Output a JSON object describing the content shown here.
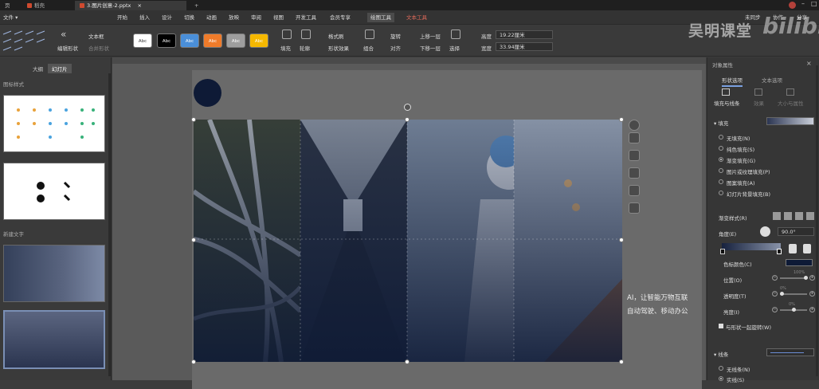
{
  "tabs": [
    {
      "label": "页",
      "active": false
    },
    {
      "label": "稻壳",
      "active": false
    },
    {
      "label": "3.图片创意-2.pptx",
      "active": true
    }
  ],
  "menu": {
    "file": "文件",
    "items": [
      "开始",
      "插入",
      "设计",
      "切换",
      "动画",
      "放映",
      "审阅",
      "视图",
      "开发工具",
      "会员专享"
    ],
    "active_tool": "绘图工具",
    "text_tool": "文本工具",
    "right_items": [
      "未同步",
      "协作",
      "分享"
    ]
  },
  "ribbon": {
    "text_box": "文本框",
    "merge_shapes": "合并形状",
    "edit_shape": "编辑形状",
    "style_swatches": [
      {
        "label": "Abc",
        "bg": "#ffffff",
        "fg": "#333333"
      },
      {
        "label": "Abc",
        "bg": "#000000",
        "fg": "#ffffff"
      },
      {
        "label": "Abc",
        "bg": "#4a8fd9",
        "fg": "#ffffff"
      },
      {
        "label": "Abc",
        "bg": "#ef7b2a",
        "fg": "#ffffff"
      },
      {
        "label": "Abc",
        "bg": "#9e9e9e",
        "fg": "#ffffff"
      },
      {
        "label": "Abc",
        "bg": "#f5b800",
        "fg": "#ffffff"
      }
    ],
    "fill": "填充",
    "outline": "轮廓",
    "format_painter": "格式刷",
    "shape_effects": "形状效果",
    "group": "组合",
    "rotate": "旋转",
    "align": "对齐",
    "bring_forward": "上移一层",
    "send_backward": "下移一层",
    "select": "选择",
    "height_label": "高度",
    "height_value": "19.22厘米",
    "width_label": "宽度",
    "width_value": "33.94厘米"
  },
  "left_panel": {
    "tab_outline": "大纲",
    "tab_slides": "幻灯片",
    "section1": "图标样式",
    "section2": "新建文字"
  },
  "slide": {
    "caption_line1": "AI，让智能万物互联",
    "caption_line2": "自动驾驶、移动办公"
  },
  "right_panel": {
    "title": "对象属性",
    "tab_shape": "形状选项",
    "tab_text": "文本选项",
    "sub_fill_line": "填充与线条",
    "sub_effects": "效果",
    "sub_size": "大小与属性",
    "fill_header": "填充",
    "fill_options": [
      {
        "label": "无填充(N)",
        "selected": false
      },
      {
        "label": "纯色填充(S)",
        "selected": false
      },
      {
        "label": "渐变填充(G)",
        "selected": true
      },
      {
        "label": "图片或纹理填充(P)",
        "selected": false
      },
      {
        "label": "图案填充(A)",
        "selected": false
      },
      {
        "label": "幻灯片背景填充(B)",
        "selected": false
      }
    ],
    "gradient_style": "渐变样式(R)",
    "angle_label": "角度(E)",
    "angle_value": "90.0°",
    "stop_color": "色标颜色(C)",
    "position_label": "位置(O)",
    "position_value": "100%",
    "transparency_label": "透明度(T)",
    "transparency_value": "0%",
    "brightness_label": "亮度(I)",
    "brightness_value": "0%",
    "rotate_with_shape": "与形状一起旋转(W)",
    "line_header": "线条",
    "no_line": "无线条(N)",
    "solid_line": "实线(S)"
  },
  "watermark": {
    "text": "吴明课堂",
    "logo": "bilibili"
  },
  "colors": {
    "navy": "#0e1a36",
    "accent_red": "#e06a5a",
    "gradient_dark": "#16213d"
  }
}
